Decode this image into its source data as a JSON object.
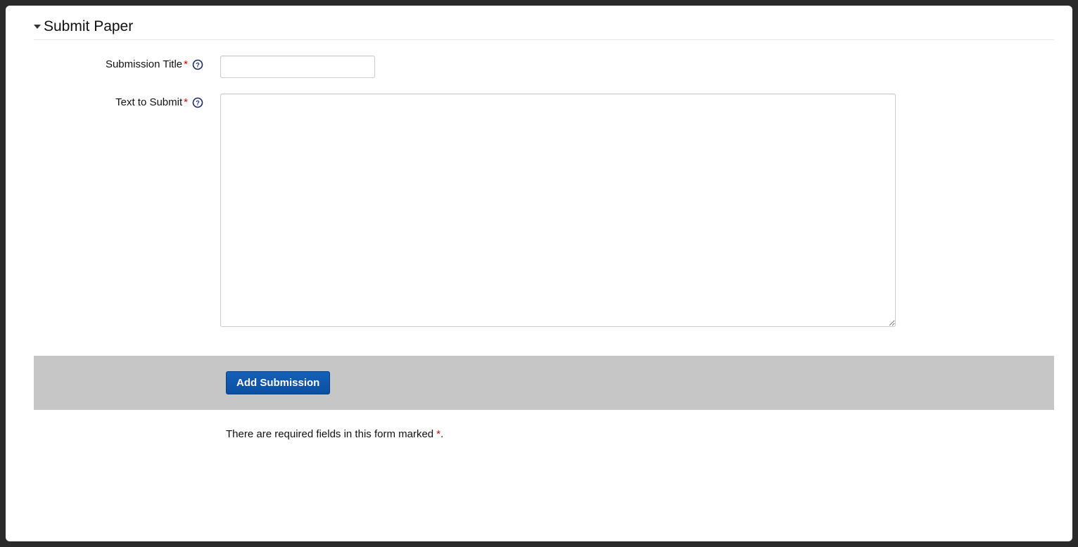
{
  "section": {
    "title": "Submit Paper"
  },
  "fields": {
    "title": {
      "label": "Submission Title",
      "value": ""
    },
    "text": {
      "label": "Text to Submit",
      "value": ""
    }
  },
  "button": {
    "submit": "Add Submission"
  },
  "note": {
    "prefix": "There are required fields in this form marked ",
    "star": "*",
    "suffix": "."
  },
  "required_marker": "*"
}
